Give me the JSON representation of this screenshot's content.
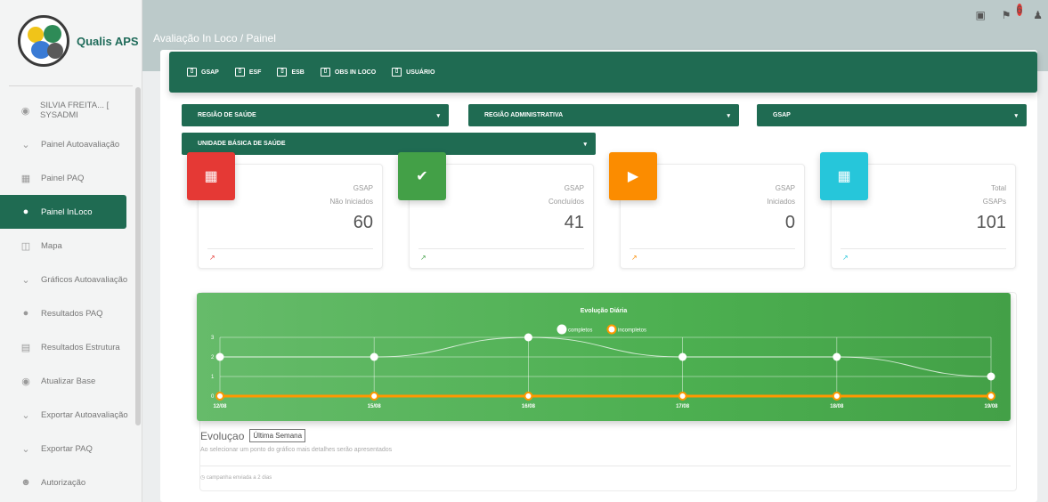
{
  "app": {
    "logo_text": "Qualis APS",
    "breadcrumb": "Avaliação In Loco / Painel",
    "notification_count": "6"
  },
  "sidebar": {
    "items": [
      {
        "label": "SILVIA FREITA... [ SYSADMI",
        "icon": "user-circle-icon"
      },
      {
        "label": "Painel Autoavaliação",
        "icon": "chevron-down-icon"
      },
      {
        "label": "Painel PAQ",
        "icon": "dashboard-icon"
      },
      {
        "label": "Painel InLoco",
        "icon": "lightbulb-icon"
      },
      {
        "label": "Mapa",
        "icon": "map-icon"
      },
      {
        "label": "Gráficos Autoavaliação",
        "icon": "chevron-down-icon"
      },
      {
        "label": "Resultados PAQ",
        "icon": "lightbulb-icon"
      },
      {
        "label": "Resultados Estrutura",
        "icon": "report-icon"
      },
      {
        "label": "Atualizar Base",
        "icon": "info-icon"
      },
      {
        "label": "Exportar Autoavaliação",
        "icon": "chevron-down-icon"
      },
      {
        "label": "Exportar PAQ",
        "icon": "chevron-down-icon"
      },
      {
        "label": "Autorização",
        "icon": "person-add-icon"
      }
    ]
  },
  "tabs": [
    "GSAP",
    "ESF",
    "ESB",
    "OBS IN LOCO",
    "USUÁRIO"
  ],
  "filters": {
    "regiao_saude": "REGIÃO DE SAÚDE",
    "regiao_administrativa": "REGIÃO ADMINISTRATIVA",
    "gsap": "GSAP",
    "ubs": "UNIDADE BÁSICA DE SAÚDE"
  },
  "cards": [
    {
      "line1": "GSAP",
      "line2": "Não Iniciados",
      "value": "60",
      "color": "#e53935",
      "icon": "dashboard-icon"
    },
    {
      "line1": "GSAP",
      "line2": "Concluídos",
      "value": "41",
      "color": "#43a047",
      "icon": "check-circle-icon"
    },
    {
      "line1": "GSAP",
      "line2": "Iniciados",
      "value": "0",
      "color": "#fb8c00",
      "icon": "play-icon"
    },
    {
      "line1": "Total",
      "line2": "GSAPs",
      "value": "101",
      "color": "#26c6da",
      "icon": "contact-icon"
    }
  ],
  "chart_data": {
    "type": "line",
    "title": "Evolução Diária",
    "categories": [
      "12/08",
      "15/08",
      "16/08",
      "17/08",
      "18/08",
      "19/08"
    ],
    "series": [
      {
        "name": "completos",
        "values": [
          2,
          2,
          3,
          2,
          2,
          1
        ],
        "color": "#ffffff"
      },
      {
        "name": "incompletos",
        "values": [
          0,
          0,
          0,
          0,
          0,
          0
        ],
        "color": "#ff9800"
      }
    ],
    "ylim": [
      0,
      3
    ],
    "yticks": [
      "0",
      "1",
      "2",
      "3"
    ],
    "legend": "top-center",
    "grid": true
  },
  "evolution": {
    "label": "Evoluçao",
    "period_button": "Última Semana",
    "hint": "Ao selecionar um ponto do gráfico mais detalhes serão apresentados",
    "footer": "campanha enviada a 2 dias"
  }
}
